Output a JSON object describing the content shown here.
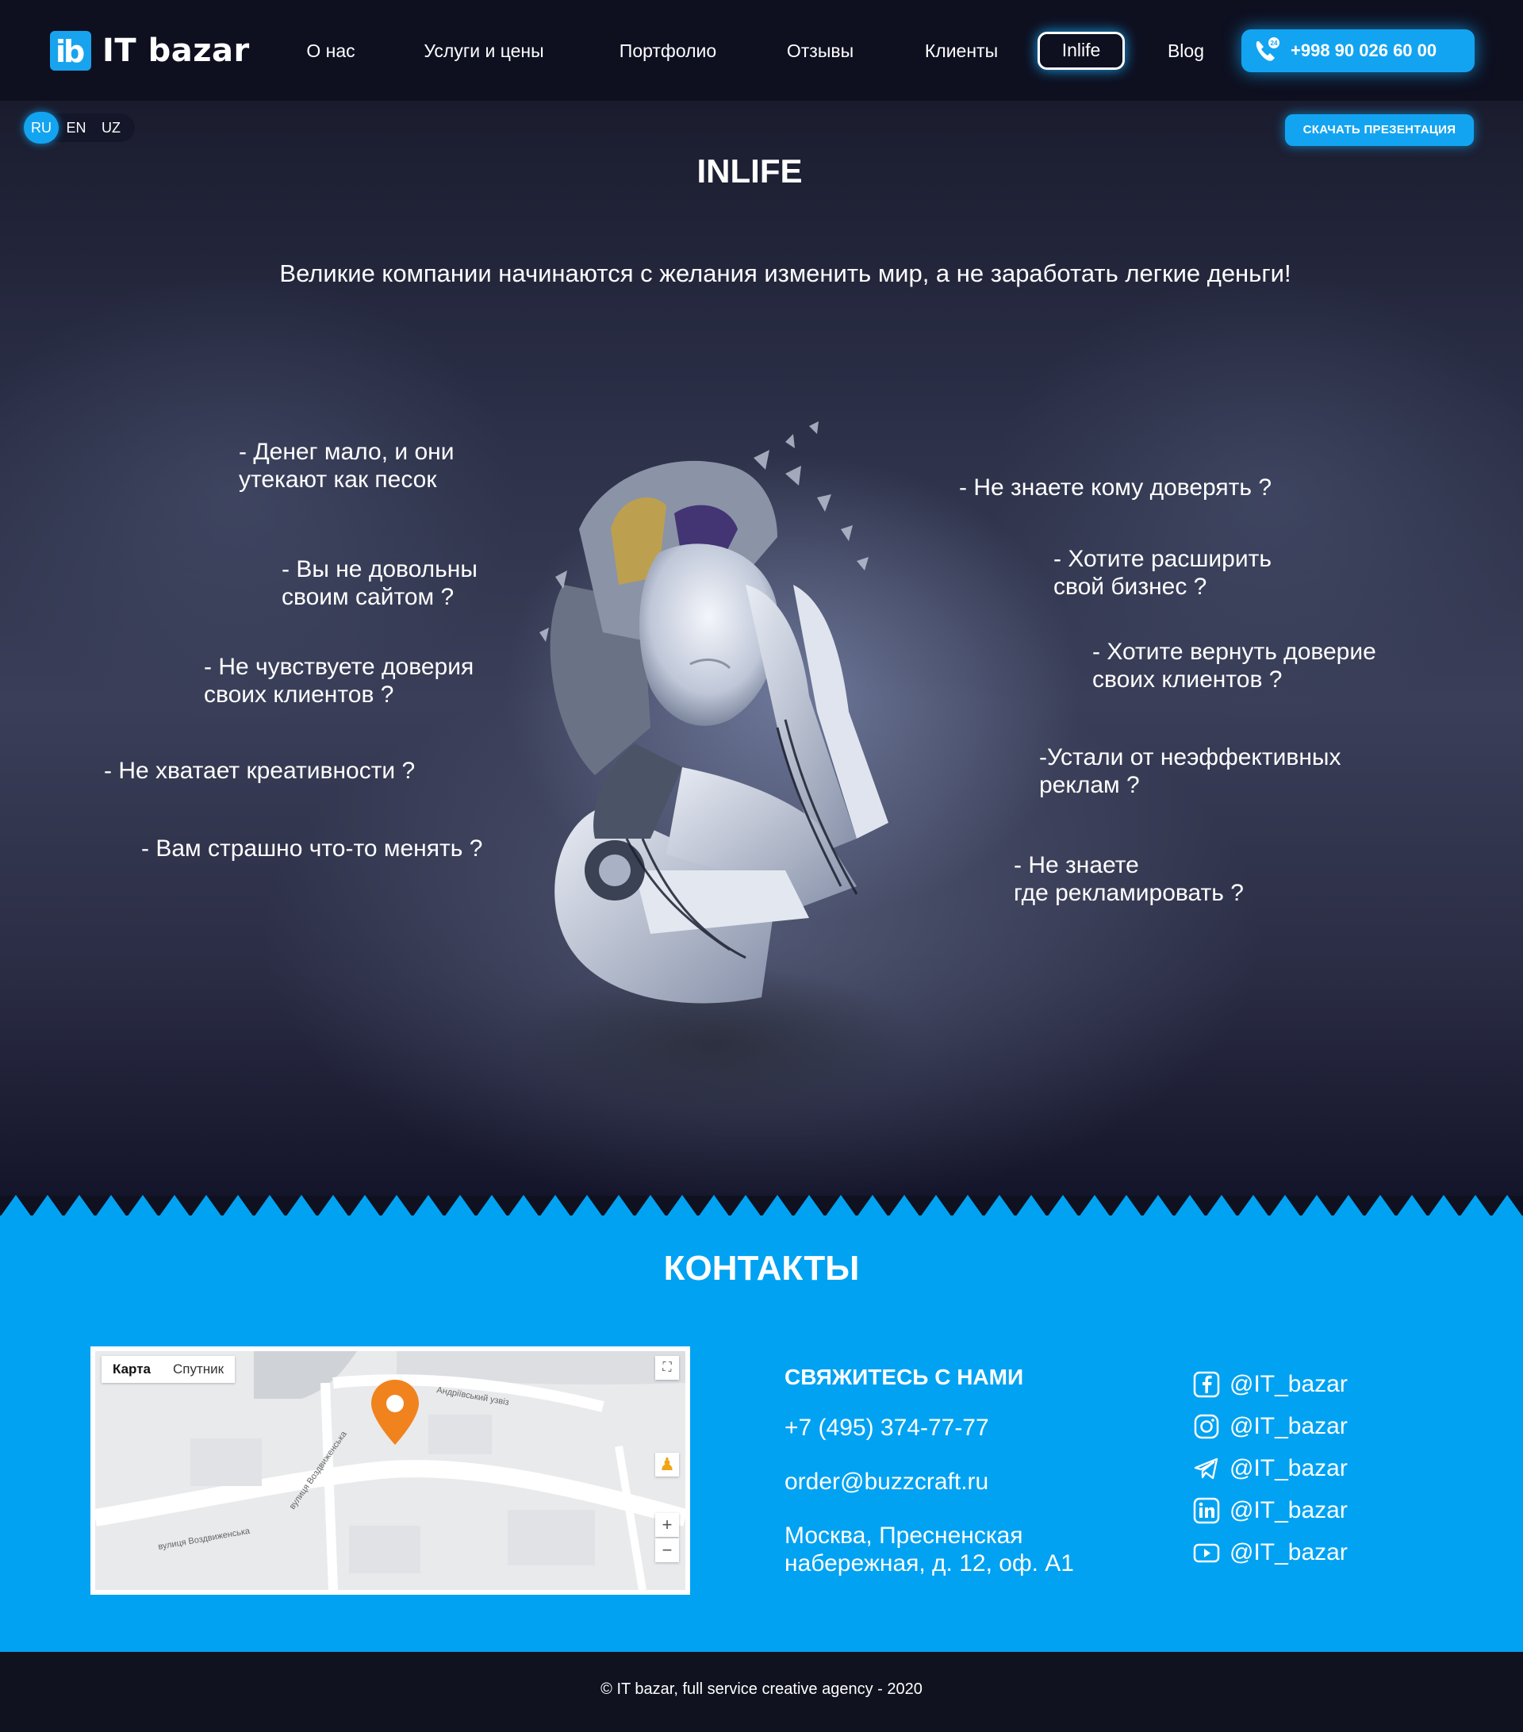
{
  "header": {
    "logo_badge": "ib",
    "logo_text": "IT bazar",
    "nav": [
      "О нас",
      "Услуги и цены",
      "Портфолио",
      "Отзывы",
      "Клиенты",
      "Inlife",
      "Blog"
    ],
    "active_nav": "Inlife",
    "phone": "+998 90 026 60 00",
    "phone_badge": "24"
  },
  "hero": {
    "languages": [
      "RU",
      "EN",
      "UZ"
    ],
    "active_language": "RU",
    "presentation_button": "СКАЧАТЬ ПРЕЗЕНТАЦИЯ",
    "title": "INLIFE",
    "subtitle": "Великие компании начинаются с желания изменить мир, а не заработать легкие деньги!",
    "questions_left": [
      "- Денег мало, и они\nутекают как песок",
      "- Вы не довольны\nсвоим сайтом ?",
      "- Не чувствуете доверия\nсвоих клиентов ?",
      "- Не хватает креативности ?",
      "- Вам страшно что-то менять ?"
    ],
    "questions_right": [
      "- Не знаете кому доверять ?",
      "- Хотите расширить\nсвой бизнес ?",
      "- Хотите вернуть доверие\nсвоих клиентов ?",
      "-Устали от неэффективных\nреклам ?",
      "- Не знаете\nгде рекламировать ?"
    ]
  },
  "contacts": {
    "title": "КОНТАКТЫ",
    "map_tabs": [
      "Карта",
      "Спутник"
    ],
    "map_streets": [
      "Андріївський узвіз",
      "вулиця Воздвиженська",
      "вулиця Воздвиженська"
    ],
    "heading": "СВЯЖИТЕСЬ С НАМИ",
    "phone": "+7 (495) 374-77-77",
    "email": "order@buzzcraft.ru",
    "address": "Москва, Пресненская\nнабережная, д. 12, оф. А1",
    "socials": [
      {
        "icon": "facebook-icon",
        "label": "@IT_bazar"
      },
      {
        "icon": "instagram-icon",
        "label": "@IT_bazar"
      },
      {
        "icon": "telegram-icon",
        "label": "@IT_bazar"
      },
      {
        "icon": "linkedin-icon",
        "label": "@IT_bazar"
      },
      {
        "icon": "youtube-icon",
        "label": "@IT_bazar"
      }
    ]
  },
  "footer": {
    "copyright": "© IT bazar, full service creative agency - 2020"
  },
  "colors": {
    "accent": "#13a4f1",
    "contacts_bg": "#01a2f2",
    "header_bg": "#0e1020",
    "map_pin": "#f0831e"
  }
}
